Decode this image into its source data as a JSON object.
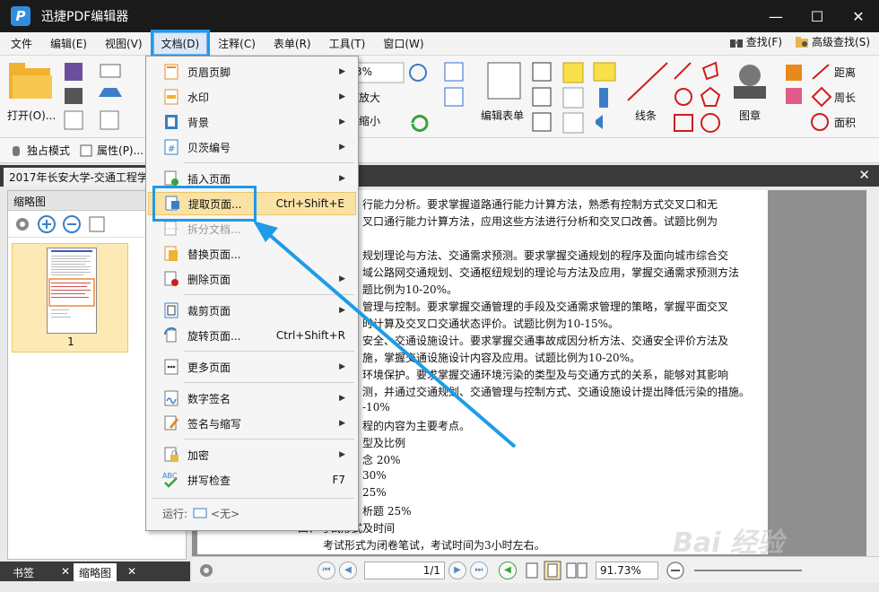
{
  "app": {
    "title": "迅捷PDF编辑器",
    "logo_letter": "P"
  },
  "window": {
    "minimize": "—",
    "maximize": "☐",
    "close": "✕"
  },
  "menubar": {
    "items": [
      "文件",
      "编辑(E)",
      "视图(V)",
      "文档(D)",
      "注释(C)",
      "表单(R)",
      "工具(T)",
      "窗口(W)"
    ],
    "right": {
      "find": "查找(F)",
      "advanced_find": "高级查找(S)"
    }
  },
  "ribbon": {
    "open": "打开(O)...",
    "zoom_value": "3%",
    "zoom_in": "放大",
    "zoom_out": "缩小",
    "edit_form": "编辑表单",
    "line": "线条",
    "stamp": "图章",
    "distance": "距离",
    "perimeter": "周长",
    "area": "面积"
  },
  "subbar": {
    "exclusive": "独占模式",
    "properties": "属性(P)..."
  },
  "doctab": {
    "name": "2017年长安大学-交通工程学",
    "close": "✕"
  },
  "leftpanel": {
    "title": "缩略图",
    "page_num": "1"
  },
  "lefttabs": {
    "bookmark": "书签",
    "thumbnail": "缩略图",
    "x": "✕"
  },
  "document": {
    "lines": [
      "行能力分析。要求掌握道路通行能力计算方法，熟悉有控制方式交叉口和无",
      "叉口通行能力计算方法，应用这些方法进行分析和交叉口改善。试题比例为",
      "",
      "规划理论与方法、交通需求预测。要求掌握交通规划的程序及面向城市综合交",
      "域公路网交通规划、交通枢纽规划的理论与方法及应用，掌握交通需求预测方法",
      "题比例为10-20%。",
      "管理与控制。要求掌握交通管理的手段及交通需求管理的策略，掌握平面交叉",
      "时计算及交叉口交通状态评价。试题比例为10-15%。",
      "安全、交通设施设计。要求掌握交通事故成因分析方法、交通安全评价方法及",
      "施，掌握交通设施设计内容及应用。试题比例为10-20%。",
      "环境保护。要求掌握交通环境污染的类型及与交通方式的关系，能够对其影响",
      "测，并通过交通规划、交通管理与控制方式、交通设施设计提出降低污染的措施。",
      "-10%",
      "程的内容为主要考点。",
      "型及比例",
      "念      20%",
      "         30%",
      "         25%",
      "析题   25%",
      "四、考试形式及时间",
      "考试形式为闭卷笔试，考试时间为3小时左右。"
    ]
  },
  "statusbar": {
    "page": "1/1",
    "zoom": "91.73%"
  },
  "dropdown": {
    "items": [
      {
        "label": "页眉页脚",
        "shortcut": "",
        "submenu": true,
        "icon": "header-footer-icon"
      },
      {
        "label": "水印",
        "shortcut": "",
        "submenu": true,
        "icon": "watermark-icon"
      },
      {
        "label": "背景",
        "shortcut": "",
        "submenu": true,
        "icon": "background-icon"
      },
      {
        "label": "贝茨编号",
        "shortcut": "",
        "submenu": true,
        "icon": "bates-number-icon"
      },
      {
        "label": "插入页面",
        "shortcut": "",
        "submenu": true,
        "icon": "insert-page-icon"
      },
      {
        "label": "提取页面...",
        "shortcut": "Ctrl+Shift+E",
        "submenu": false,
        "icon": "extract-page-icon"
      },
      {
        "label": "拆分文档...",
        "shortcut": "",
        "submenu": false,
        "icon": "split-document-icon"
      },
      {
        "label": "替换页面...",
        "shortcut": "",
        "submenu": false,
        "icon": "replace-page-icon"
      },
      {
        "label": "删除页面",
        "shortcut": "",
        "submenu": true,
        "icon": "delete-page-icon"
      },
      {
        "label": "裁剪页面",
        "shortcut": "",
        "submenu": true,
        "icon": "crop-page-icon"
      },
      {
        "label": "旋转页面...",
        "shortcut": "Ctrl+Shift+R",
        "submenu": false,
        "icon": "rotate-page-icon"
      },
      {
        "label": "更多页面",
        "shortcut": "",
        "submenu": true,
        "icon": "more-pages-icon"
      },
      {
        "label": "数字签名",
        "shortcut": "",
        "submenu": true,
        "icon": "digital-signature-icon"
      },
      {
        "label": "签名与缩写",
        "shortcut": "",
        "submenu": true,
        "icon": "signature-initials-icon"
      },
      {
        "label": "加密",
        "shortcut": "",
        "submenu": true,
        "icon": "encrypt-icon"
      },
      {
        "label": "拼写检查",
        "shortcut": "F7",
        "submenu": false,
        "icon": "spell-check-icon"
      }
    ],
    "run_label": "运行:",
    "run_value": "<无>",
    "arrow": "▶"
  },
  "watermark": "Bai 经验",
  "colors": {
    "accent": "#1e9be6",
    "highlight": "#f9e2a4"
  }
}
